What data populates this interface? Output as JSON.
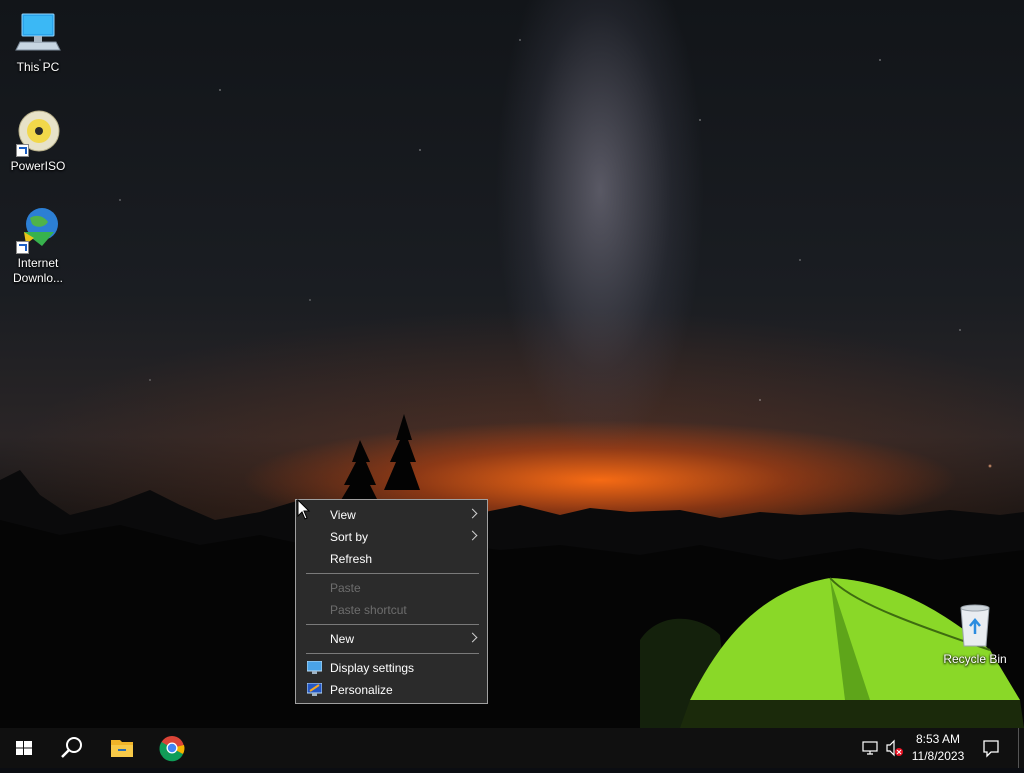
{
  "desktop": {
    "icons": [
      {
        "name": "this-pc",
        "label": "This PC",
        "icon": "computer-icon"
      },
      {
        "name": "poweriso",
        "label": "PowerISO",
        "icon": "disc-icon"
      },
      {
        "name": "internet-download-manager",
        "label": "Internet\nDownlo...",
        "icon": "idm-globe-icon"
      },
      {
        "name": "recycle-bin",
        "label": "Recycle Bin",
        "icon": "recycle-bin-icon"
      }
    ]
  },
  "context_menu": {
    "items": [
      {
        "label": "View",
        "submenu": true,
        "enabled": true
      },
      {
        "label": "Sort by",
        "submenu": true,
        "enabled": true
      },
      {
        "label": "Refresh",
        "submenu": false,
        "enabled": true
      },
      {
        "label": "Paste",
        "submenu": false,
        "enabled": false
      },
      {
        "label": "Paste shortcut",
        "submenu": false,
        "enabled": false
      },
      {
        "label": "New",
        "submenu": true,
        "enabled": true
      },
      {
        "label": "Display settings",
        "submenu": false,
        "enabled": true,
        "icon": "display-settings-icon"
      },
      {
        "label": "Personalize",
        "submenu": false,
        "enabled": true,
        "icon": "personalize-icon"
      }
    ]
  },
  "taskbar": {
    "pinned": [
      "windows-start-icon",
      "search-icon",
      "file-explorer-icon",
      "chrome-icon"
    ],
    "tray": {
      "time": "8:53 AM",
      "date": "11/8/2023",
      "icons": [
        "network-icon",
        "volume-muted-icon",
        "notifications-icon"
      ]
    }
  },
  "colors": {
    "menu_bg": "#2b2b2b",
    "taskbar_bg": "#101010",
    "horizon_glow": "#ff6e14",
    "tent_green": "#8ad828"
  }
}
